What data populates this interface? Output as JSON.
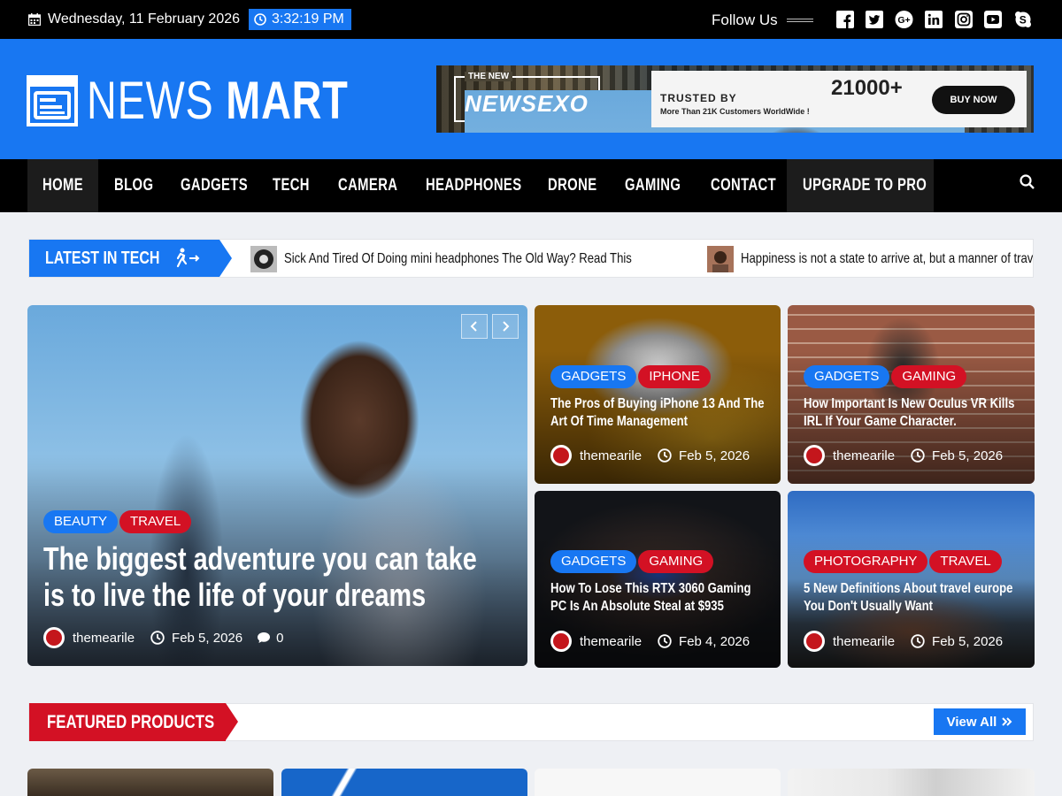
{
  "topbar": {
    "date": "Wednesday, 11 February 2026",
    "time": "3:32:19 PM",
    "follow_label": "Follow Us",
    "socials": [
      "facebook-icon",
      "twitter-icon",
      "google-plus-icon",
      "linkedin-icon",
      "instagram-icon",
      "youtube-icon",
      "skype-icon"
    ]
  },
  "header": {
    "logo_word1": "NEWS",
    "logo_word2": "MART",
    "banner": {
      "small": "THE NEW",
      "brand": "NEWSEXO",
      "trusted": "TRUSTED BY",
      "more": "More Than 21K Customers WorldWide !",
      "count": "21000+",
      "buy": "BUY NOW"
    }
  },
  "nav": {
    "items": [
      "HOME",
      "BLOG",
      "GADGETS",
      "TECH",
      "CAMERA",
      "HEADPHONES",
      "DRONE",
      "GAMING",
      "CONTACT",
      "UPGRADE TO PRO"
    ],
    "active": "HOME"
  },
  "ticker": {
    "label": "LATEST IN TECH",
    "items": [
      "Sick And Tired Of Doing mini headphones The Old Way? Read This",
      "Happiness is not a state to arrive at, but a manner of traveling"
    ]
  },
  "main_post": {
    "cats": [
      "BEAUTY",
      "TRAVEL"
    ],
    "title": "The biggest adventure you can take is to live the life of your dreams",
    "author": "themearile",
    "date": "Feb 5, 2026",
    "comments": "0"
  },
  "side_posts": [
    {
      "cats": [
        "GADGETS",
        "IPHONE"
      ],
      "title": "The Pros of Buying iPhone 13 And The Art Of Time Management",
      "author": "themearile",
      "date": "Feb 5, 2026"
    },
    {
      "cats": [
        "GADGETS",
        "GAMING"
      ],
      "title": "How Important Is New Oculus VR Kills IRL If Your Game Character.",
      "author": "themearile",
      "date": "Feb 5, 2026"
    },
    {
      "cats": [
        "GADGETS",
        "GAMING"
      ],
      "title": "How To Lose This RTX 3060 Gaming PC Is An Absolute Steal at $935",
      "author": "themearile",
      "date": "Feb 4, 2026"
    },
    {
      "cats": [
        "PHOTOGRAPHY",
        "TRAVEL"
      ],
      "title": "5 New Definitions About travel europe You Don't Usually Want",
      "author": "themearile",
      "date": "Feb 5, 2026"
    }
  ],
  "featured": {
    "label": "FEATURED PRODUCTS",
    "view_all": "View All"
  },
  "colors": {
    "brand_blue": "#1877f2",
    "accent_red": "#d31124",
    "topbar_black": "#000000"
  }
}
